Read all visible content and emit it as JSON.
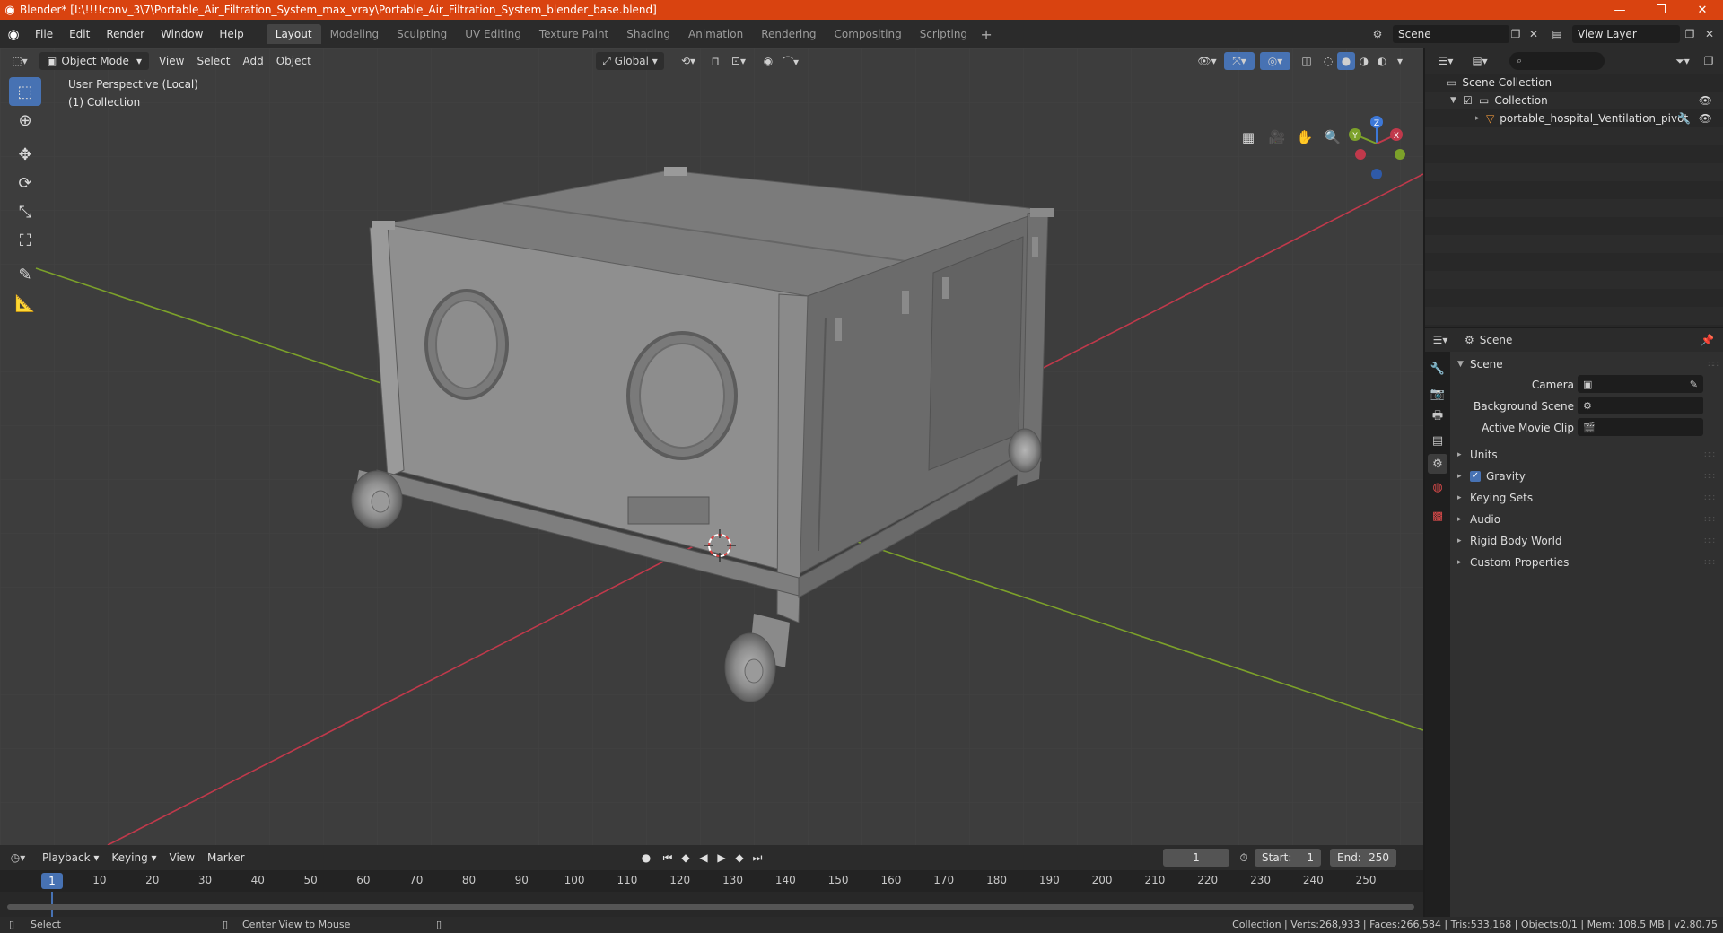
{
  "titlebar": {
    "title": "Blender* [I:\\!!!!conv_3\\7\\Portable_Air_Filtration_System_max_vray\\Portable_Air_Filtration_System_blender_base.blend]",
    "app_icon": "blender-icon",
    "minimize": "—",
    "restore": "❐",
    "close": "✕"
  },
  "menu": [
    "File",
    "Edit",
    "Render",
    "Window",
    "Help"
  ],
  "workspaces": [
    "Layout",
    "Modeling",
    "Sculpting",
    "UV Editing",
    "Texture Paint",
    "Shading",
    "Animation",
    "Rendering",
    "Compositing",
    "Scripting"
  ],
  "active_workspace": "Layout",
  "scene_selector": {
    "value": "Scene"
  },
  "view_layer_selector": {
    "value": "View Layer"
  },
  "viewport": {
    "mode": "Object Mode",
    "menus": [
      "View",
      "Select",
      "Add",
      "Object"
    ],
    "transform_orientation": "Global",
    "info_line1": "User Perspective (Local)",
    "info_line2": "(1) Collection",
    "gizmo": {
      "z": "Z",
      "y": "Y",
      "x": "X"
    }
  },
  "toolbar_tools": [
    "select-box-icon",
    "cursor-icon",
    "move-icon",
    "rotate-icon",
    "scale-icon",
    "transform-icon",
    "annotate-icon",
    "measure-icon"
  ],
  "timeline": {
    "menus": [
      "Playback",
      "Keying",
      "View",
      "Marker"
    ],
    "current_frame": "1",
    "start_label": "Start:",
    "start": "1",
    "end_label": "End:",
    "end": "250",
    "ticks": [
      "10",
      "20",
      "30",
      "40",
      "50",
      "60",
      "70",
      "80",
      "90",
      "100",
      "110",
      "120",
      "130",
      "140",
      "150",
      "160",
      "170",
      "180",
      "190",
      "200",
      "210",
      "220",
      "230",
      "240",
      "250"
    ],
    "marker": "1"
  },
  "statusbar": {
    "select": "Select",
    "center_view": "Center View to Mouse",
    "stats": "Collection | Verts:268,933 | Faces:266,584 | Tris:533,168 | Objects:0/1 | Mem: 108.5 MB | v2.80.75"
  },
  "outliner": {
    "scene_collection": "Scene Collection",
    "collection": "Collection",
    "object": "portable_hospital_Ventilation_pivot"
  },
  "properties": {
    "context": "Scene",
    "panel_title": "Scene",
    "camera_label": "Camera",
    "background_scene_label": "Background Scene",
    "active_movie_clip_label": "Active Movie Clip",
    "subpanels": {
      "units": "Units",
      "gravity": "Gravity",
      "keying_sets": "Keying Sets",
      "audio": "Audio",
      "rigid_body_world": "Rigid Body World",
      "custom_properties": "Custom Properties"
    }
  },
  "colors": {
    "titlebar": "#d94310",
    "accent": "#4772b3",
    "viewport_bg": "#3d3d3d",
    "axis_x": "#c0394b",
    "axis_y": "#7ca12a"
  }
}
